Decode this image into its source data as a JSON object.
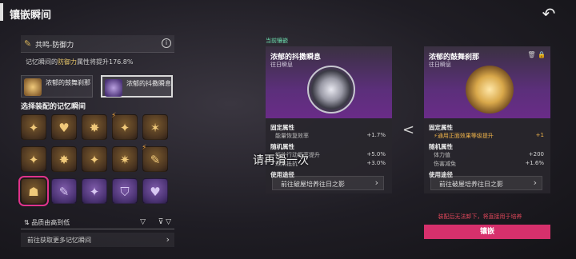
{
  "header": {
    "title": "镶嵌瞬间"
  },
  "left": {
    "set_name": "共鸣-防御力",
    "effect_prefix": "记忆瞬间的",
    "effect_highlight": "防御力",
    "effect_suffix": "属性将提升176.8%",
    "slots": [
      {
        "name": "浓郁的鼓舞刹那",
        "icon": "gold-drum-icon"
      },
      {
        "name": "浓郁的抖擞瞬息",
        "icon": "purple-star-icon"
      }
    ],
    "section_title": "选择装配的记忆瞬间",
    "grid": [
      {
        "style": "gold",
        "glyph": "✦",
        "bolt": false
      },
      {
        "style": "gold",
        "glyph": "♥",
        "bolt": false
      },
      {
        "style": "gold",
        "glyph": "✸",
        "bolt": false
      },
      {
        "style": "gold",
        "glyph": "✦",
        "bolt": true
      },
      {
        "style": "gold",
        "glyph": "✶",
        "bolt": false
      },
      {
        "style": "gold",
        "glyph": "✦",
        "bolt": false
      },
      {
        "style": "gold",
        "glyph": "✸",
        "bolt": false
      },
      {
        "style": "gold",
        "glyph": "✦",
        "bolt": false
      },
      {
        "style": "gold",
        "glyph": "✷",
        "bolt": false
      },
      {
        "style": "gold",
        "glyph": "✎",
        "bolt": true
      },
      {
        "style": "gold",
        "glyph": "☗",
        "bolt": false
      },
      {
        "style": "purple",
        "glyph": "✎",
        "bolt": false
      },
      {
        "style": "purple",
        "glyph": "✦",
        "bolt": false
      },
      {
        "style": "purple",
        "glyph": "⛉",
        "bolt": false
      },
      {
        "style": "purple",
        "glyph": "♥",
        "bolt": false
      }
    ],
    "sort_label": "品质由高到低",
    "get_more": "前往获取更多记忆瞬间"
  },
  "current_tag": "当前镶嵌",
  "card_current": {
    "name": "浓郁的抖擞瞬息",
    "sub": "往日瞬息",
    "fixed_title": "固定属性",
    "fixed": [
      {
        "label": "能量恢复效率",
        "value": "+1.7%"
      }
    ],
    "random_title": "随机属性",
    "random": [
      {
        "label": "额外行动概率提升",
        "value": "+5.0%"
      },
      {
        "label": "效果抵抗",
        "value": "+3.0%"
      }
    ],
    "usage_title": "使用途径",
    "path": "前往破屋培养往日之影"
  },
  "card_new": {
    "name": "浓郁的鼓舞刹那",
    "sub": "往日瞬息",
    "fixed_title": "固定属性",
    "fixed": [
      {
        "label": "通用正面效果等级提升",
        "value": "+1"
      }
    ],
    "random_title": "随机属性",
    "random": [
      {
        "label": "体力值",
        "value": "+200"
      },
      {
        "label": "伤害减免",
        "value": "+1.6%"
      }
    ],
    "usage_title": "使用途径",
    "path": "前往破屋培养往日之影"
  },
  "toast": "请再滑一次",
  "warning": "装配后无法卸下，将直接用于培养",
  "embed_button": "镶嵌",
  "colors": {
    "accent": "#d6306c",
    "gold": "#e8c76a",
    "purple": "#6a2c88"
  }
}
